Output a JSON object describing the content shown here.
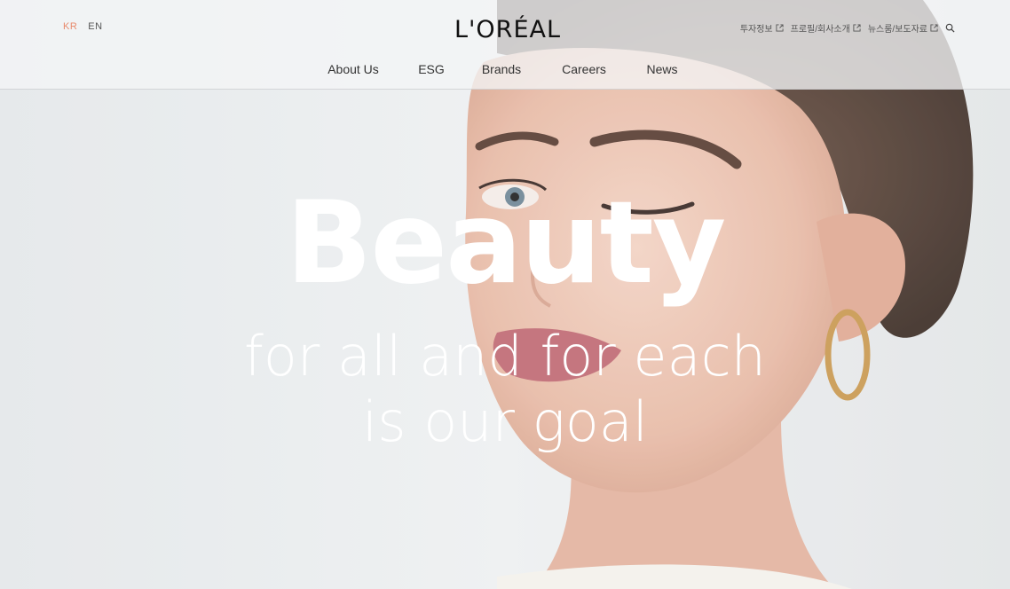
{
  "header": {
    "languages": [
      {
        "label": "KR",
        "active": true
      },
      {
        "label": "EN",
        "active": false
      }
    ],
    "logo_text": "L'ORÉAL",
    "utility_links": [
      {
        "label": "투자정보",
        "icon": "external-link-icon"
      },
      {
        "label": "프로필/회사소개",
        "icon": "external-link-icon"
      },
      {
        "label": "뉴스룸/보도자료",
        "icon": "external-link-icon"
      }
    ],
    "search_icon": "search-icon",
    "nav": [
      "About Us",
      "ESG",
      "Brands",
      "Careers",
      "News"
    ]
  },
  "hero": {
    "title": "Beauty",
    "subtitle_line1": "for all and for each",
    "subtitle_line2": "is our goal"
  },
  "colors": {
    "active_language": "#e88a6c",
    "hero_text": "#ffffff",
    "background": "#e9eced"
  }
}
